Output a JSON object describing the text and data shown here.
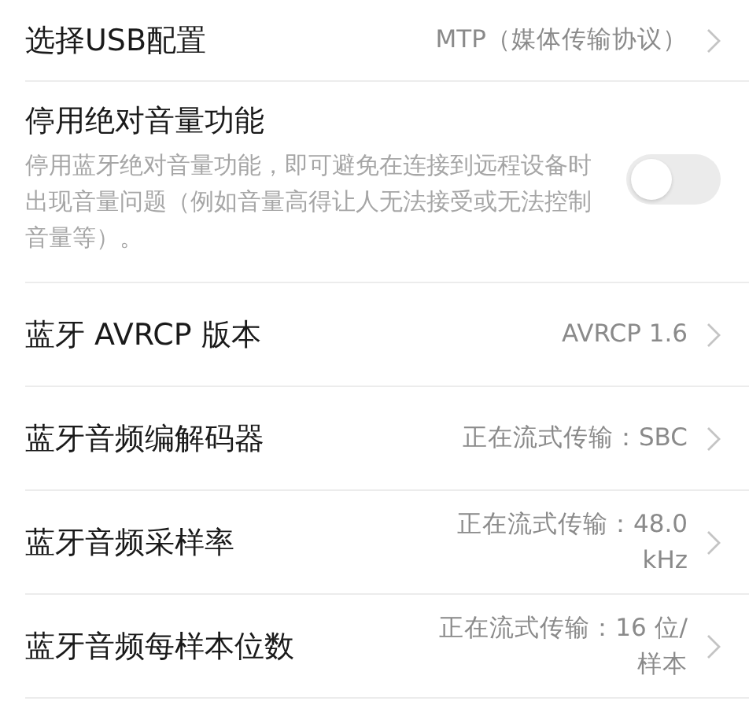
{
  "settings": [
    {
      "kind": "link",
      "title": "选择USB配置",
      "value": "MTP（媒体传输协议）"
    },
    {
      "kind": "toggle",
      "title": "停用绝对音量功能",
      "description": "停用蓝牙绝对音量功能，即可避免在连接到远程设备时出现音量问题（例如音量高得让人无法接受或无法控制音量等）。",
      "on": false
    },
    {
      "kind": "link",
      "title": "蓝牙 AVRCP 版本",
      "value": "AVRCP 1.6"
    },
    {
      "kind": "link",
      "title": "蓝牙音频编解码器",
      "value": "正在流式传输：SBC"
    },
    {
      "kind": "link",
      "title": "蓝牙音频采样率",
      "value": "正在流式传输：48.0\nkHz"
    },
    {
      "kind": "link",
      "title": "蓝牙音频每样本位数",
      "value": "正在流式传输：16 位/\n样本"
    }
  ]
}
